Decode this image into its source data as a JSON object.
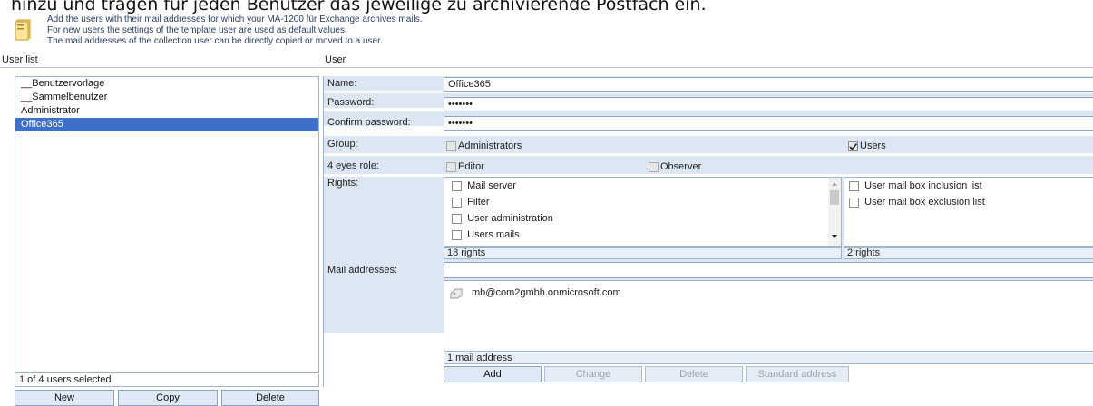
{
  "heading": "hinzu und tragen für jeden Benutzer das jeweilige zu archivierende Postfach ein.",
  "info": {
    "icon": "info-book-icon",
    "lines": [
      "Add the users with their mail addresses for which your MA-1200 für Exchange archives mails.",
      "For new users the settings of the template user are used as default values.",
      "The mail addresses of the collection user can be directly copied or moved to a user."
    ]
  },
  "user_list": {
    "title": "User list",
    "items": [
      "__Benutzervorlage",
      "__Sammelbenutzer",
      "Administrator",
      "Office365"
    ],
    "selected_index": 3,
    "status": "1 of 4 users selected",
    "buttons": {
      "new": "New",
      "copy": "Copy",
      "delete": "Delete"
    }
  },
  "user": {
    "title": "User",
    "name_label": "Name:",
    "name_value": "Office365",
    "password_label": "Password:",
    "password_value": "•••••••",
    "confirm_label": "Confirm password:",
    "confirm_value": "•••••••",
    "group_label": "Group:",
    "group_options": [
      {
        "label": "Administrators",
        "checked": false
      },
      {
        "label": "Users",
        "checked": true
      }
    ],
    "eyes_label": "4 eyes role:",
    "eyes_options": [
      {
        "label": "Editor",
        "checked": false
      },
      {
        "label": "Observer",
        "checked": false
      }
    ],
    "rights_label": "Rights:",
    "rights_left": [
      "Mail server",
      "Filter",
      "User administration",
      "Users mails"
    ],
    "rights_left_status": "18 rights",
    "rights_right": [
      "User mail box inclusion list",
      "User mail box exclusion list"
    ],
    "rights_right_status": "2 rights",
    "mail_label": "Mail addresses:",
    "mail_input": "",
    "mail_items": [
      "mb@com2gmbh.onmicrosoft.com"
    ],
    "mail_icon": "mail-address-icon",
    "mail_status": "1 mail address",
    "buttons": {
      "add": "Add",
      "change": "Change",
      "delete": "Delete",
      "standard": "Standard address"
    }
  },
  "colors": {
    "accent": "#3d6fcb",
    "row_bg": "#dde7f4",
    "border": "#9fb4d2"
  }
}
